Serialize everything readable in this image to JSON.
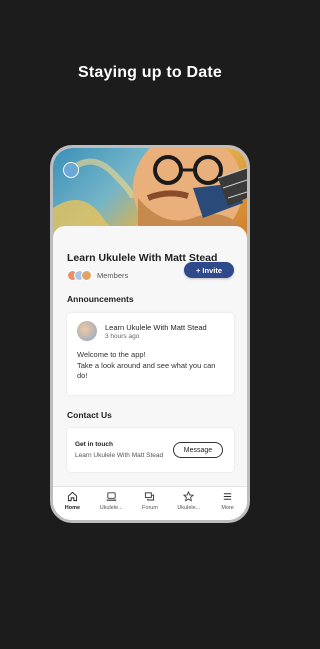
{
  "headline": "Staying up to Date",
  "group": {
    "title": "Learn Ukulele With Matt Stead",
    "members_label": "Members",
    "invite_label": "+ Invite"
  },
  "announcements": {
    "section_title": "Announcements",
    "post": {
      "author": "Learn Ukulele With Matt Stead",
      "time": "3 hours ago",
      "body": "Welcome to the app!\nTake a look around and see what you can do!"
    }
  },
  "contact": {
    "section_title": "Contact Us",
    "title": "Get in touch",
    "subtitle": "Learn Ukulele With Matt Stead",
    "message_label": "Message"
  },
  "tabs": [
    {
      "label": "Home",
      "icon": "home-icon"
    },
    {
      "label": "Ukulele...",
      "icon": "laptop-icon"
    },
    {
      "label": "Forum",
      "icon": "chat-icon"
    },
    {
      "label": "Ukulele...",
      "icon": "star-icon"
    },
    {
      "label": "More",
      "icon": "menu-icon"
    }
  ],
  "colors": {
    "background": "#1c1c1c",
    "accent": "#2f4a8a"
  }
}
